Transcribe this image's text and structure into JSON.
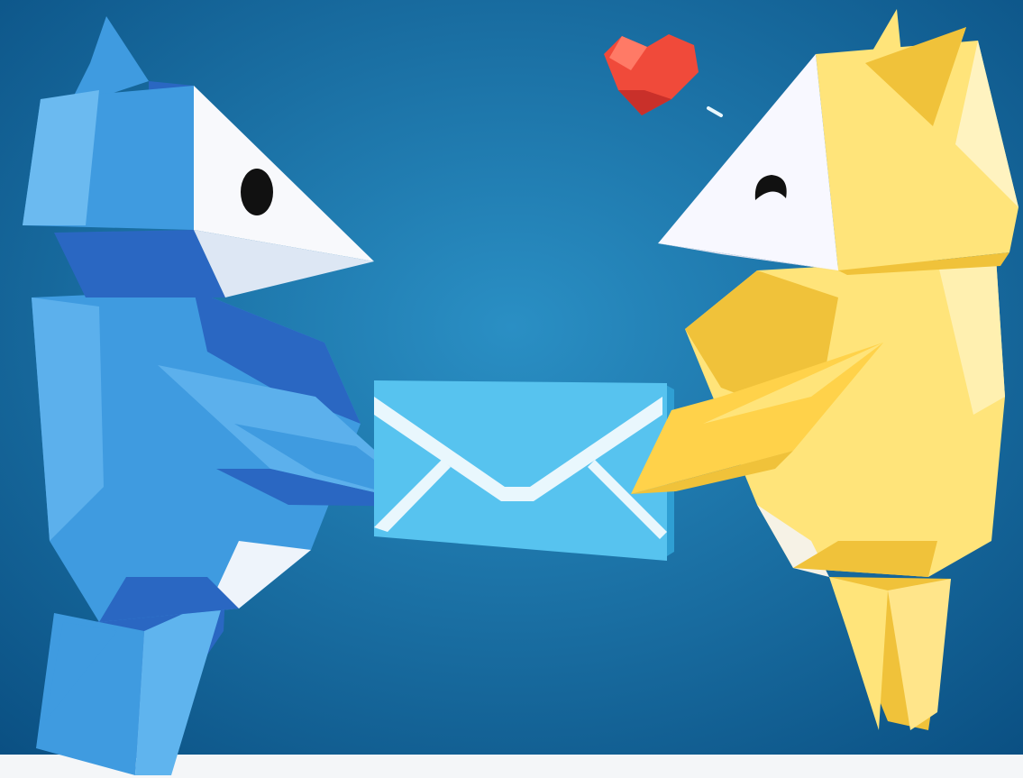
{
  "scene": {
    "background": {
      "center_color": "#2a8fc4",
      "edge_color": "#0a4f82",
      "floor_color": "#f4f6f8"
    },
    "characters": [
      {
        "name": "blue-creature",
        "color": "#3f9be0",
        "shadow_color": "#2a67c2",
        "face_color": "#ffffff",
        "expression": "neutral"
      },
      {
        "name": "yellow-creature",
        "color": "#ffe47a",
        "shadow_color": "#f0c23a",
        "face_color": "#f8f8ff",
        "expression": "shy"
      }
    ],
    "envelope": {
      "color": "#57c3ef",
      "stripe_color": "#e9f7fd"
    },
    "heart": {
      "color": "#f04a3a",
      "highlight_color": "#ff7a66"
    },
    "icons": [
      "heart-icon",
      "envelope-icon"
    ]
  }
}
